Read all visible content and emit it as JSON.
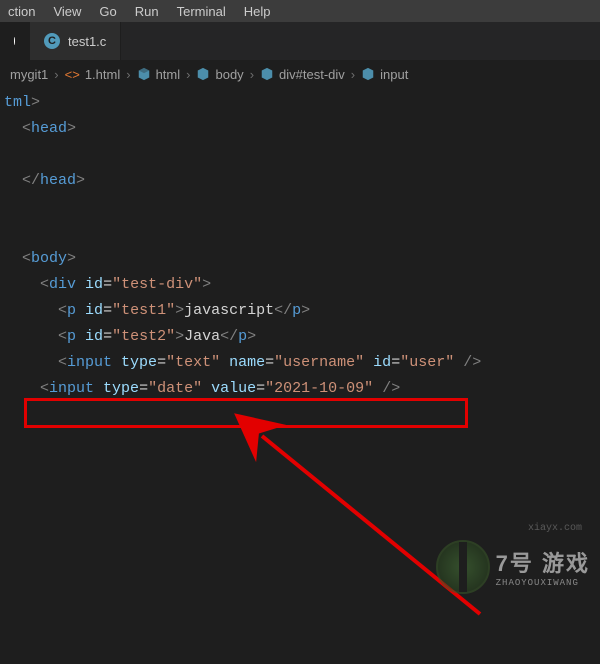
{
  "menubar": {
    "items": [
      "ction",
      "View",
      "Go",
      "Run",
      "Terminal",
      "Help"
    ]
  },
  "tabs": [
    {
      "icon_letter": "C",
      "label": "test1.c",
      "modified": true
    }
  ],
  "breadcrumb": {
    "segments": [
      {
        "type": "folder",
        "text": "mygit1"
      },
      {
        "type": "file",
        "text": "1.html"
      },
      {
        "type": "sym",
        "text": "html"
      },
      {
        "type": "sym",
        "text": "body"
      },
      {
        "type": "sym",
        "text": "div#test-div"
      },
      {
        "type": "sym",
        "text": "input"
      }
    ]
  },
  "code": {
    "l0": "tml",
    "head_open": "head",
    "head_close": "head",
    "body_open": "body",
    "div_tag": "div",
    "div_attr_id": "id",
    "div_id_val": "\"test-div\"",
    "p_tag": "p",
    "p1_id_val": "\"test1\"",
    "p1_text": "javascript",
    "p2_id_val": "\"test2\"",
    "p2_text": "Java",
    "input_tag": "input",
    "attr_type": "type",
    "attr_name": "name",
    "attr_id": "id",
    "attr_value": "value",
    "type_text": "\"text\"",
    "name_user": "\"username\"",
    "id_user": "\"user\"",
    "type_date": "\"date\"",
    "date_val": "\"2021-10-09\""
  },
  "watermark": {
    "cn": "7号 游戏",
    "en": "ZHAOYOUXIWANG",
    "url": "xiayx.com"
  }
}
